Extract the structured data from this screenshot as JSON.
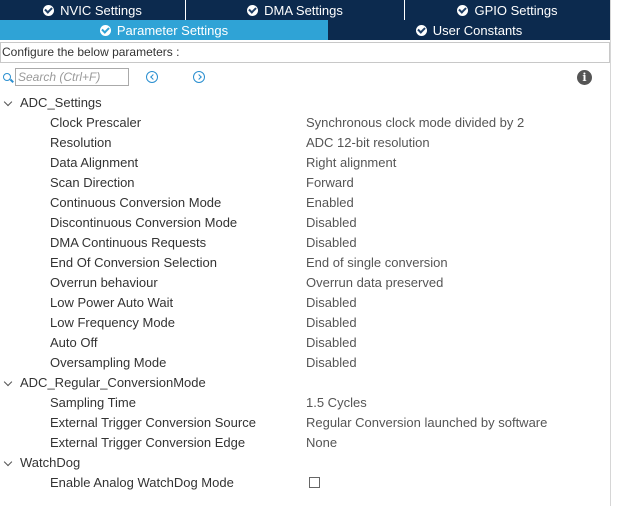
{
  "tabs_row1": [
    {
      "label": "NVIC Settings"
    },
    {
      "label": "DMA Settings"
    },
    {
      "label": "GPIO Settings"
    }
  ],
  "tabs_row2": [
    {
      "label": "Parameter Settings",
      "active": true
    },
    {
      "label": "User Constants",
      "active": false
    }
  ],
  "configure_label": "Configure the below parameters :",
  "search": {
    "placeholder": "Search (Ctrl+F)",
    "value": ""
  },
  "groups": [
    {
      "name": "ADC_Settings",
      "params": [
        {
          "name": "Clock Prescaler",
          "value": "Synchronous clock mode divided by 2"
        },
        {
          "name": "Resolution",
          "value": "ADC 12-bit resolution"
        },
        {
          "name": "Data Alignment",
          "value": "Right alignment"
        },
        {
          "name": "Scan Direction",
          "value": "Forward"
        },
        {
          "name": "Continuous Conversion Mode",
          "value": "Enabled"
        },
        {
          "name": "Discontinuous Conversion Mode",
          "value": "Disabled"
        },
        {
          "name": "DMA Continuous Requests",
          "value": "Disabled"
        },
        {
          "name": "End Of Conversion Selection",
          "value": "End of single conversion"
        },
        {
          "name": "Overrun behaviour",
          "value": "Overrun data preserved"
        },
        {
          "name": "Low Power Auto Wait",
          "value": "Disabled"
        },
        {
          "name": "Low Frequency Mode",
          "value": "Disabled"
        },
        {
          "name": "Auto Off",
          "value": "Disabled"
        },
        {
          "name": "Oversampling Mode",
          "value": "Disabled"
        }
      ]
    },
    {
      "name": "ADC_Regular_ConversionMode",
      "params": [
        {
          "name": "Sampling Time",
          "value": "1.5 Cycles"
        },
        {
          "name": "External Trigger Conversion Source",
          "value": "Regular Conversion launched by software"
        },
        {
          "name": "External Trigger Conversion Edge",
          "value": "None"
        }
      ]
    },
    {
      "name": "WatchDog",
      "params": [
        {
          "name": "Enable Analog WatchDog Mode",
          "checkbox": true,
          "checked": false
        }
      ]
    }
  ],
  "colors": {
    "tab_dark": "#0c2a4e",
    "tab_active": "#2fa3d6",
    "accent": "#2a8fd0"
  }
}
